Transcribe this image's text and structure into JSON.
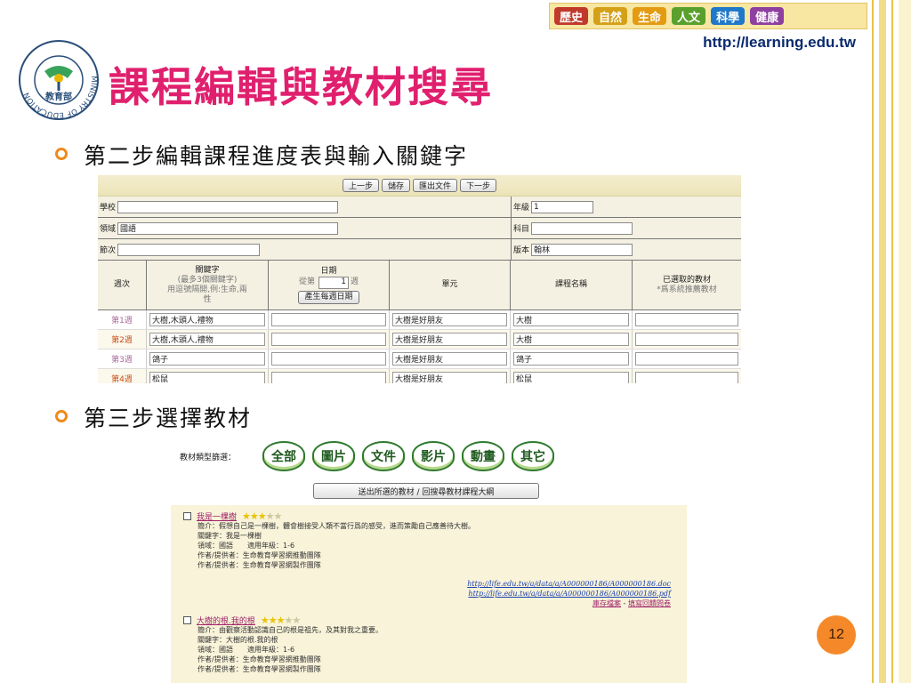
{
  "banner": {
    "tabs": [
      {
        "label": "歷史",
        "color": "#c0392b"
      },
      {
        "label": "自然",
        "color": "#d4a017"
      },
      {
        "label": "生命",
        "color": "#e39b12"
      },
      {
        "label": "人文",
        "color": "#5aa02c"
      },
      {
        "label": "科學",
        "color": "#1f78c8"
      },
      {
        "label": "健康",
        "color": "#8e3fa0"
      }
    ]
  },
  "url": "http://learning.edu.tw",
  "logo": {
    "ring_text": "MINISTRY OF EDUCATION",
    "chinese": "教育部"
  },
  "title": "課程編輯與教材搜尋",
  "step2": "第二步編輯課程進度表與輸入關鍵字",
  "step3": "第三步選擇教材",
  "editor": {
    "buttons": [
      "上一步",
      "儲存",
      "匯出文件",
      "下一步"
    ],
    "school_label": "學校",
    "school_value": "",
    "grade_label": "年級",
    "grade_value": "1",
    "domain_label": "領域",
    "domain_value": "國語",
    "subject_label": "科目",
    "subject_value": "",
    "section_label": "節次",
    "section_value": "",
    "edition_label": "版本",
    "edition_value": "翰林",
    "headers": {
      "week": "週次",
      "keyword": "關鍵字",
      "keyword_sub1": "(最多3個關鍵字)",
      "keyword_sub2": "用逗號隔開,例:生命,兩",
      "keyword_sub3": "性",
      "date": "日期",
      "date_from": "從第",
      "date_from_value": "1",
      "date_unit": "週",
      "date_button": "產生每週日期",
      "unit": "單元",
      "course": "課程名稱",
      "material": "已選取的教材",
      "material_sub": "*爲系統推薦教材"
    },
    "rows": [
      {
        "week": "第1週",
        "keyword": "大樹,木頭人,禮物",
        "date": "",
        "unit": "大樹是好朋友",
        "course": "大樹",
        "material": ""
      },
      {
        "week": "第2週",
        "keyword": "大樹,木頭人,禮物",
        "date": "",
        "unit": "大樹是好朋友",
        "course": "大樹",
        "material": ""
      },
      {
        "week": "第3週",
        "keyword": "鴿子",
        "date": "",
        "unit": "大樹是好朋友",
        "course": "鴿子",
        "material": ""
      },
      {
        "week": "第4週",
        "keyword": "松鼠",
        "date": "",
        "unit": "大樹是好朋友",
        "course": "松鼠",
        "material": ""
      }
    ]
  },
  "selector": {
    "filter_label": "教材類型篩選：",
    "filters": [
      "全部",
      "圖片",
      "文件",
      "影片",
      "動畫",
      "其它"
    ],
    "submit": "送出所選的教材 / 回搜尋教材課程大綱",
    "items": [
      {
        "title": "我是一棵樹",
        "stars": 3,
        "lines": [
          "簡介：假想自己是一棵樹，體會樹接受人類不當行爲的感受，進而策勵自己應善待大樹。",
          "關鍵字：我是一棵樹",
          "領域：國語　　適用年級：1-6",
          "作者/提供者：生命教育學習網推動團隊",
          "作者/提供者：生命教育學習網製作團隊"
        ],
        "links": [
          "http://life.edu.tw/a/data/a/A000000186/A000000186.doc",
          "http://life.edu.tw/a/data/a/A000000186/A000000186.pdf"
        ],
        "actions": [
          "庫存檔案",
          "填寫回饋問卷"
        ]
      },
      {
        "title": "大樹的根.我的根",
        "stars": 3,
        "lines": [
          "簡介：由觀察活動認識自己的根是祖先，及其對我之重要。",
          "關鍵字：大樹的根.我的根",
          "領域：國語　　適用年級：1-6",
          "作者/提供者：生命教育學習網推動團隊",
          "作者/提供者：生命教育學習網製作團隊"
        ]
      }
    ]
  },
  "page_number": "12"
}
